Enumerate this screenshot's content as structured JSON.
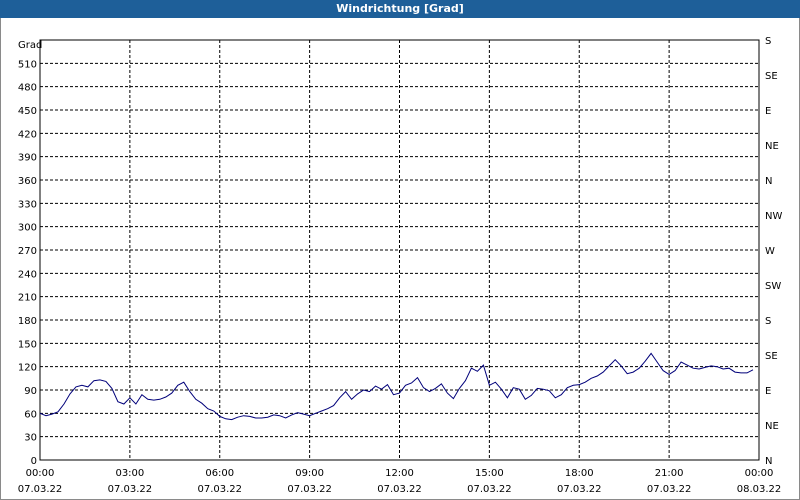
{
  "window": {
    "title": "Windrichtung [Grad]"
  },
  "colors": {
    "titlebar": "#1e5f99",
    "line": "#00007a",
    "grid": "#000000"
  },
  "chart_data": {
    "type": "line",
    "title": "Windrichtung [Grad]",
    "ylabel": "Grad",
    "xlabel": "",
    "ylim": [
      0,
      540
    ],
    "xlim_hours": [
      0,
      24
    ],
    "grid": true,
    "y_ticks": [
      "0",
      "30",
      "60",
      "90",
      "120",
      "150",
      "180",
      "210",
      "240",
      "270",
      "300",
      "330",
      "360",
      "390",
      "420",
      "450",
      "480",
      "510"
    ],
    "right_ticks": [
      "N",
      "NE",
      "E",
      "SE",
      "S",
      "SW",
      "W",
      "NW",
      "N",
      "NE",
      "E",
      "SE",
      "S"
    ],
    "x_ticks": [
      {
        "time": "00:00",
        "date": "07.03.22"
      },
      {
        "time": "03:00",
        "date": "07.03.22"
      },
      {
        "time": "06:00",
        "date": "07.03.22"
      },
      {
        "time": "09:00",
        "date": "07.03.22"
      },
      {
        "time": "12:00",
        "date": "07.03.22"
      },
      {
        "time": "15:00",
        "date": "07.03.22"
      },
      {
        "time": "18:00",
        "date": "07.03.22"
      },
      {
        "time": "21:00",
        "date": "07.03.22"
      },
      {
        "time": "00:00",
        "date": "08.03.22"
      }
    ],
    "series": [
      {
        "hours": [
          0,
          0.2,
          0.4,
          0.6,
          0.8,
          1,
          1.2,
          1.4,
          1.6,
          1.8,
          2,
          2.2,
          2.4,
          2.6,
          2.8,
          3,
          3.2,
          3.4,
          3.6,
          3.8,
          4,
          4.2,
          4.4,
          4.6,
          4.8,
          5,
          5.2,
          5.4,
          5.6,
          5.8,
          6,
          6.2,
          6.4,
          6.6,
          6.8,
          7,
          7.2,
          7.4,
          7.6,
          7.8,
          8,
          8.2,
          8.4,
          8.6,
          8.8,
          9,
          9.2,
          9.4,
          9.6,
          9.8,
          10,
          10.2,
          10.4,
          10.6,
          10.8,
          11,
          11.2,
          11.4,
          11.6,
          11.8,
          12,
          12.2,
          12.4,
          12.6,
          12.8,
          13,
          13.2,
          13.4,
          13.6,
          13.8,
          14,
          14.2,
          14.4,
          14.6,
          14.8,
          15,
          15.2,
          15.4,
          15.6,
          15.8,
          16,
          16.2,
          16.4,
          16.6,
          16.8,
          17,
          17.2,
          17.4,
          17.6,
          17.8,
          18,
          18.2,
          18.4,
          18.6,
          18.8,
          19,
          19.2,
          19.4,
          19.6,
          19.8,
          20,
          20.2,
          20.4,
          20.6,
          20.8,
          21,
          21.2,
          21.4,
          21.6,
          21.8,
          22,
          22.2,
          22.4,
          22.6,
          22.8,
          23,
          23.2,
          23.4,
          23.6,
          23.8
        ],
        "values": [
          60,
          57,
          59,
          62,
          72,
          85,
          94,
          96,
          94,
          102,
          103,
          101,
          92,
          75,
          72,
          80,
          72,
          84,
          78,
          77,
          78,
          81,
          86,
          96,
          100,
          88,
          78,
          73,
          66,
          63,
          56,
          53,
          52,
          55,
          57,
          56,
          54,
          54,
          55,
          58,
          57,
          54,
          58,
          61,
          59,
          57,
          60,
          63,
          66,
          70,
          80,
          88,
          78,
          85,
          90,
          88,
          95,
          91,
          97,
          84,
          86,
          96,
          99,
          106,
          93,
          88,
          92,
          98,
          86,
          79,
          92,
          102,
          118,
          114,
          122,
          96,
          100,
          91,
          80,
          93,
          91,
          78,
          83,
          92,
          91,
          89,
          80,
          84,
          93,
          96,
          97,
          100,
          105,
          108,
          113,
          121,
          129,
          121,
          111,
          113,
          118,
          127,
          137,
          126,
          115,
          110,
          115,
          126,
          122,
          118,
          117,
          119,
          121,
          120,
          117,
          118,
          113,
          112,
          112,
          116,
          120,
          118,
          114
        ]
      }
    ]
  }
}
